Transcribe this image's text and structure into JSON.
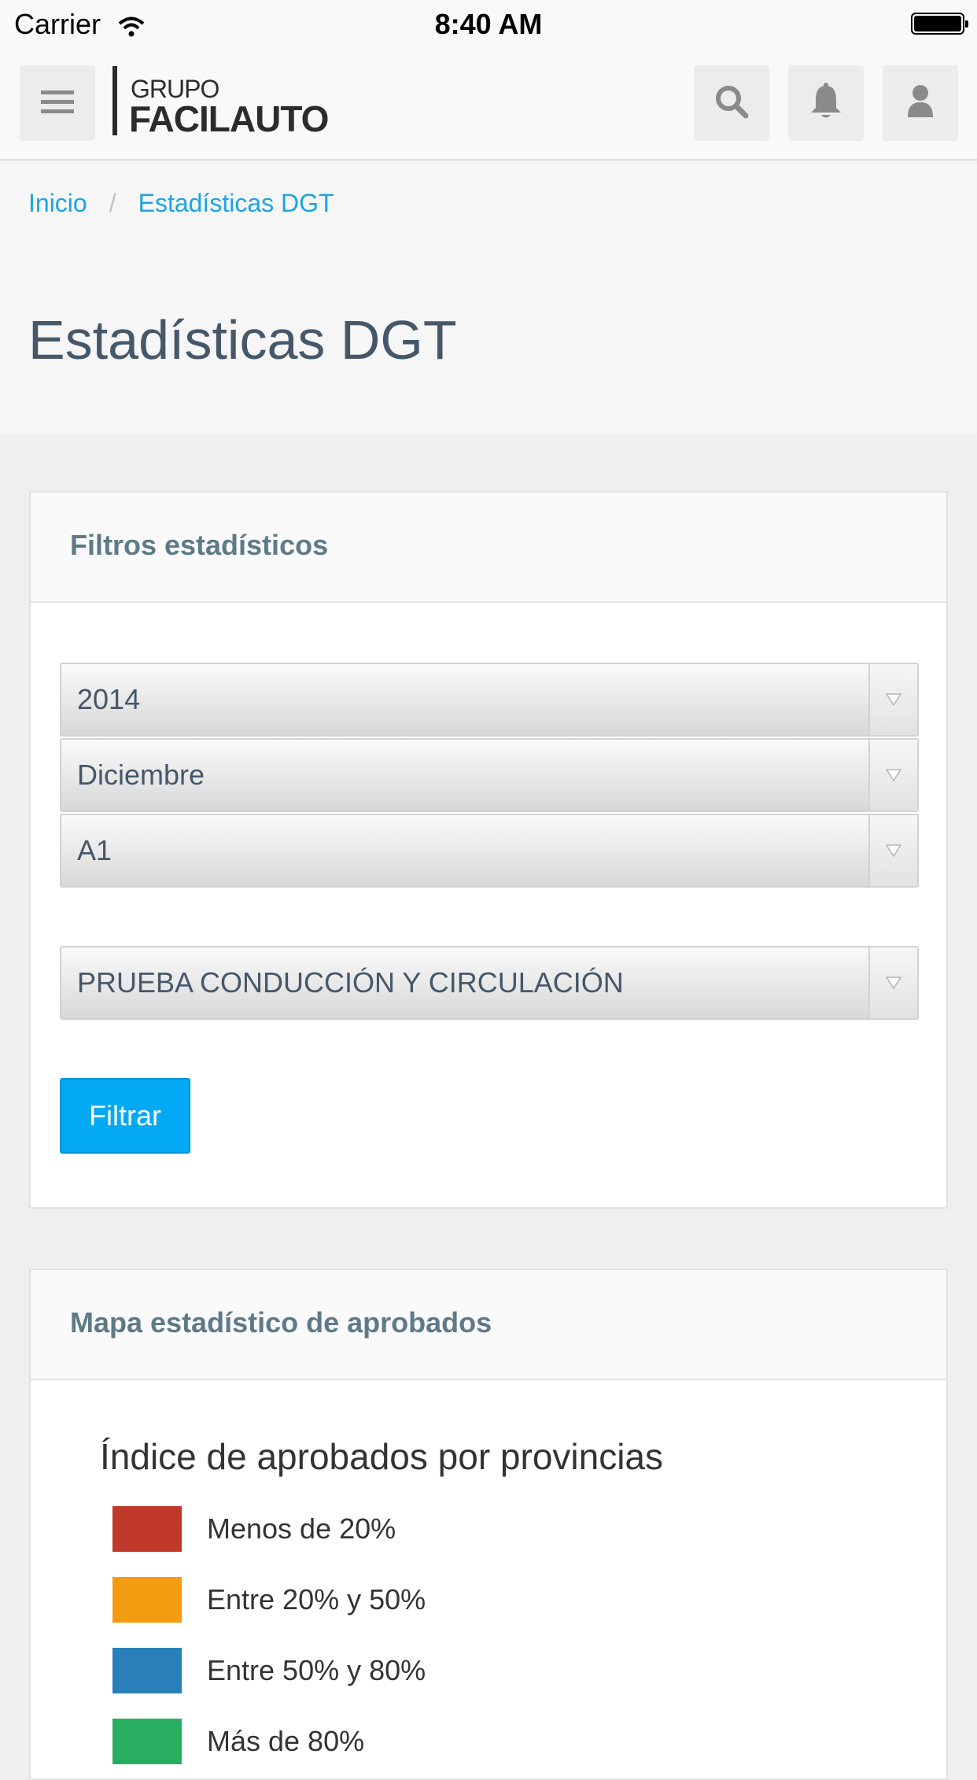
{
  "status_bar": {
    "carrier": "Carrier",
    "time": "8:40 AM"
  },
  "navbar": {
    "logo_top": "GRUPO",
    "logo_main": "FACILAUTO",
    "icons": [
      "menu-icon",
      "search-icon",
      "bell-icon",
      "user-icon"
    ]
  },
  "breadcrumb": {
    "items": [
      "Inicio",
      "Estadísticas DGT"
    ],
    "separator": "/"
  },
  "page": {
    "title": "Estadísticas DGT"
  },
  "filters": {
    "title": "Filtros estadísticos",
    "year": "2014",
    "month": "Diciembre",
    "permit": "A1",
    "test": "PRUEBA CONDUCCIÓN Y CIRCULACIÓN",
    "submit_label": "Filtrar"
  },
  "map": {
    "card_title": "Mapa estadístico de aprobados",
    "legend_title": "Índice de aprobados por provincias",
    "legend": [
      {
        "label": "Menos de 20%",
        "color": "#c0392b"
      },
      {
        "label": "Entre 20% y 50%",
        "color": "#f39c12"
      },
      {
        "label": "Entre 50% y 80%",
        "color": "#2980b9"
      },
      {
        "label": "Más de 80%",
        "color": "#27ae60"
      }
    ]
  },
  "colors": {
    "accent": "#03a9f4",
    "link": "#1ca4e2",
    "title_text": "#45586a"
  }
}
